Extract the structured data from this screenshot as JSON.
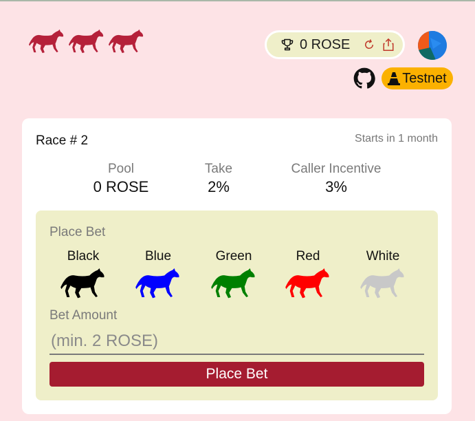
{
  "header": {
    "logo_icon": "horses-logo-icon",
    "logo_color": "#b5213a",
    "wallet": {
      "trophy_icon": "trophy-icon",
      "balance": "0 ROSE",
      "refresh_icon": "refresh-icon",
      "share_icon": "share-icon"
    },
    "avatar_icon": "account-avatar",
    "github_icon": "github-icon",
    "network": {
      "icon": "traffic-cone-icon",
      "label": "Testnet",
      "color": "#fbb100"
    }
  },
  "race": {
    "title": "Race # 2",
    "starts": "Starts in 1 month",
    "stats": {
      "pool_label": "Pool",
      "pool_value": "0 ROSE",
      "take_label": "Take",
      "take_value": "2%",
      "caller_label": "Caller Incentive",
      "caller_value": "3%"
    }
  },
  "bet": {
    "title": "Place Bet",
    "horses": [
      {
        "name": "Black",
        "color": "#000000"
      },
      {
        "name": "Blue",
        "color": "#0000ff"
      },
      {
        "name": "Green",
        "color": "#008000"
      },
      {
        "name": "Red",
        "color": "#ff0000"
      },
      {
        "name": "White",
        "color": "#c8c8c8"
      }
    ],
    "amount_label": "Bet Amount",
    "amount_placeholder": "(min. 2 ROSE)",
    "amount_value": "",
    "button_label": "Place Bet",
    "button_color": "#a51c30"
  }
}
